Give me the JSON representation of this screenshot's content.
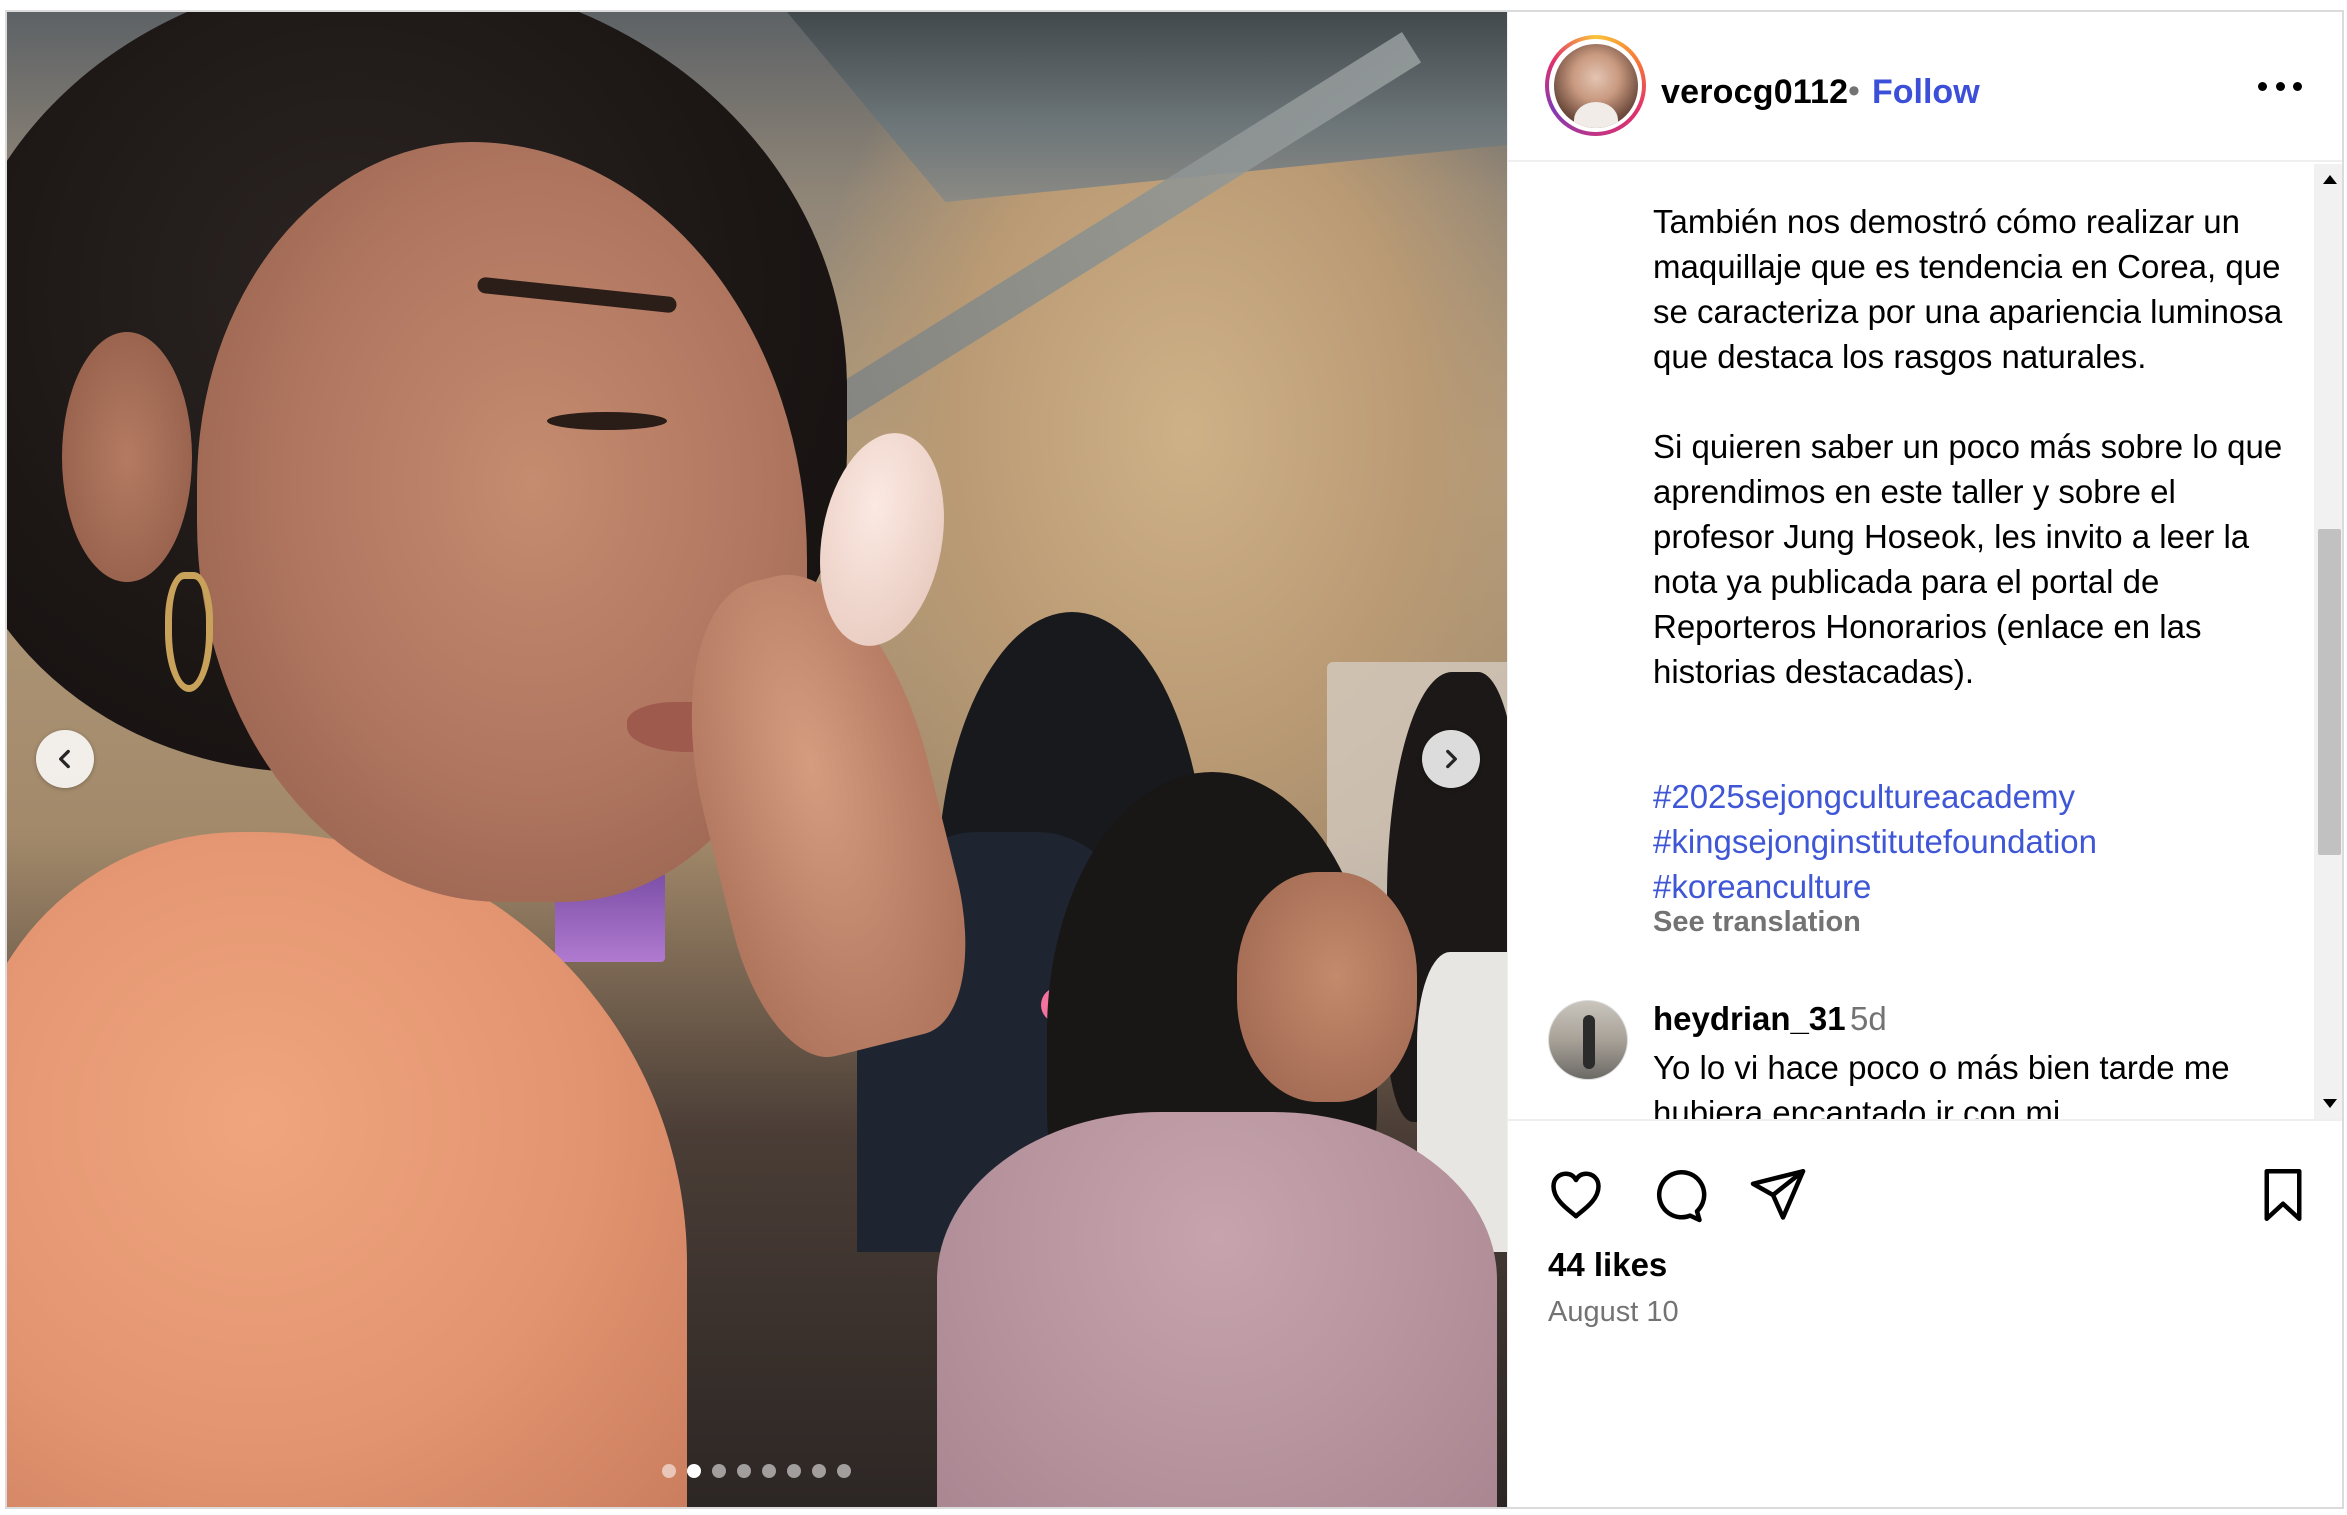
{
  "post": {
    "username": "verocg0112",
    "separator": "•",
    "follow_label": "Follow",
    "more_label": "More options",
    "media": {
      "slide_count": 8,
      "active_slide": 2,
      "prev_label": "Previous",
      "next_label": "Next"
    },
    "caption_paragraphs": [
      "También nos demostró cómo realizar un maquillaje que es tendencia en Corea, que se caracteriza por una apariencia luminosa que destaca los rasgos naturales.",
      "Si quieren saber un poco más sobre lo que aprendimos en este taller y sobre el profesor Jung Hoseok, les invito a leer la nota ya publicada para el portal de Reporteros Honorarios (enlace en las historias destacadas)."
    ],
    "hashtags": [
      "#2025sejongcultureacademy",
      "#kingsejonginstitutefoundation",
      "#koreanculture"
    ],
    "see_translation": "See translation",
    "comments": [
      {
        "username": "heydrian_31",
        "time": "5d",
        "text": "Yo lo vi hace poco o más bien tarde me hubiera encantado ir con mi"
      }
    ],
    "likes": "44 likes",
    "date": "August 10"
  },
  "icons": {
    "like": "heart-icon",
    "comment": "comment-icon",
    "share": "share-icon",
    "save": "bookmark-icon",
    "prev": "chevron-left-icon",
    "next": "chevron-right-icon"
  },
  "colors": {
    "link_blue": "#3c4fd8",
    "hashtag_blue": "#3f56d6",
    "muted_gray": "#737373",
    "border": "#dbdbdb"
  }
}
